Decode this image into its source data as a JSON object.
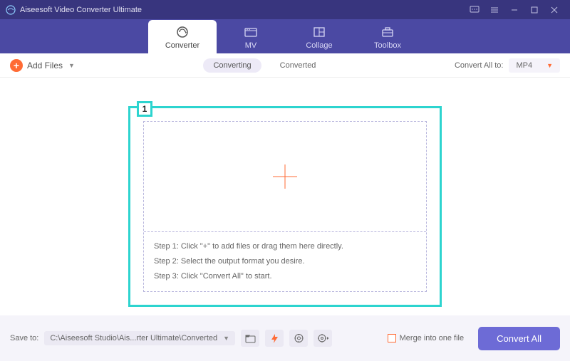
{
  "titlebar": {
    "title": "Aiseesoft Video Converter Ultimate"
  },
  "tabs": {
    "converter": "Converter",
    "mv": "MV",
    "collage": "Collage",
    "toolbox": "Toolbox"
  },
  "toolbar": {
    "add_files": "Add Files",
    "converting": "Converting",
    "converted": "Converted",
    "convert_all_to": "Convert All to:",
    "format": "MP4"
  },
  "marker": {
    "label": "1"
  },
  "steps": {
    "s1": "Step 1: Click \"+\" to add files or drag them here directly.",
    "s2": "Step 2: Select the output format you desire.",
    "s3": "Step 3: Click \"Convert All\" to start."
  },
  "footer": {
    "save_to_label": "Save to:",
    "save_path": "C:\\Aiseesoft Studio\\Ais...rter Ultimate\\Converted",
    "merge": "Merge into one file",
    "convert_all": "Convert All"
  }
}
